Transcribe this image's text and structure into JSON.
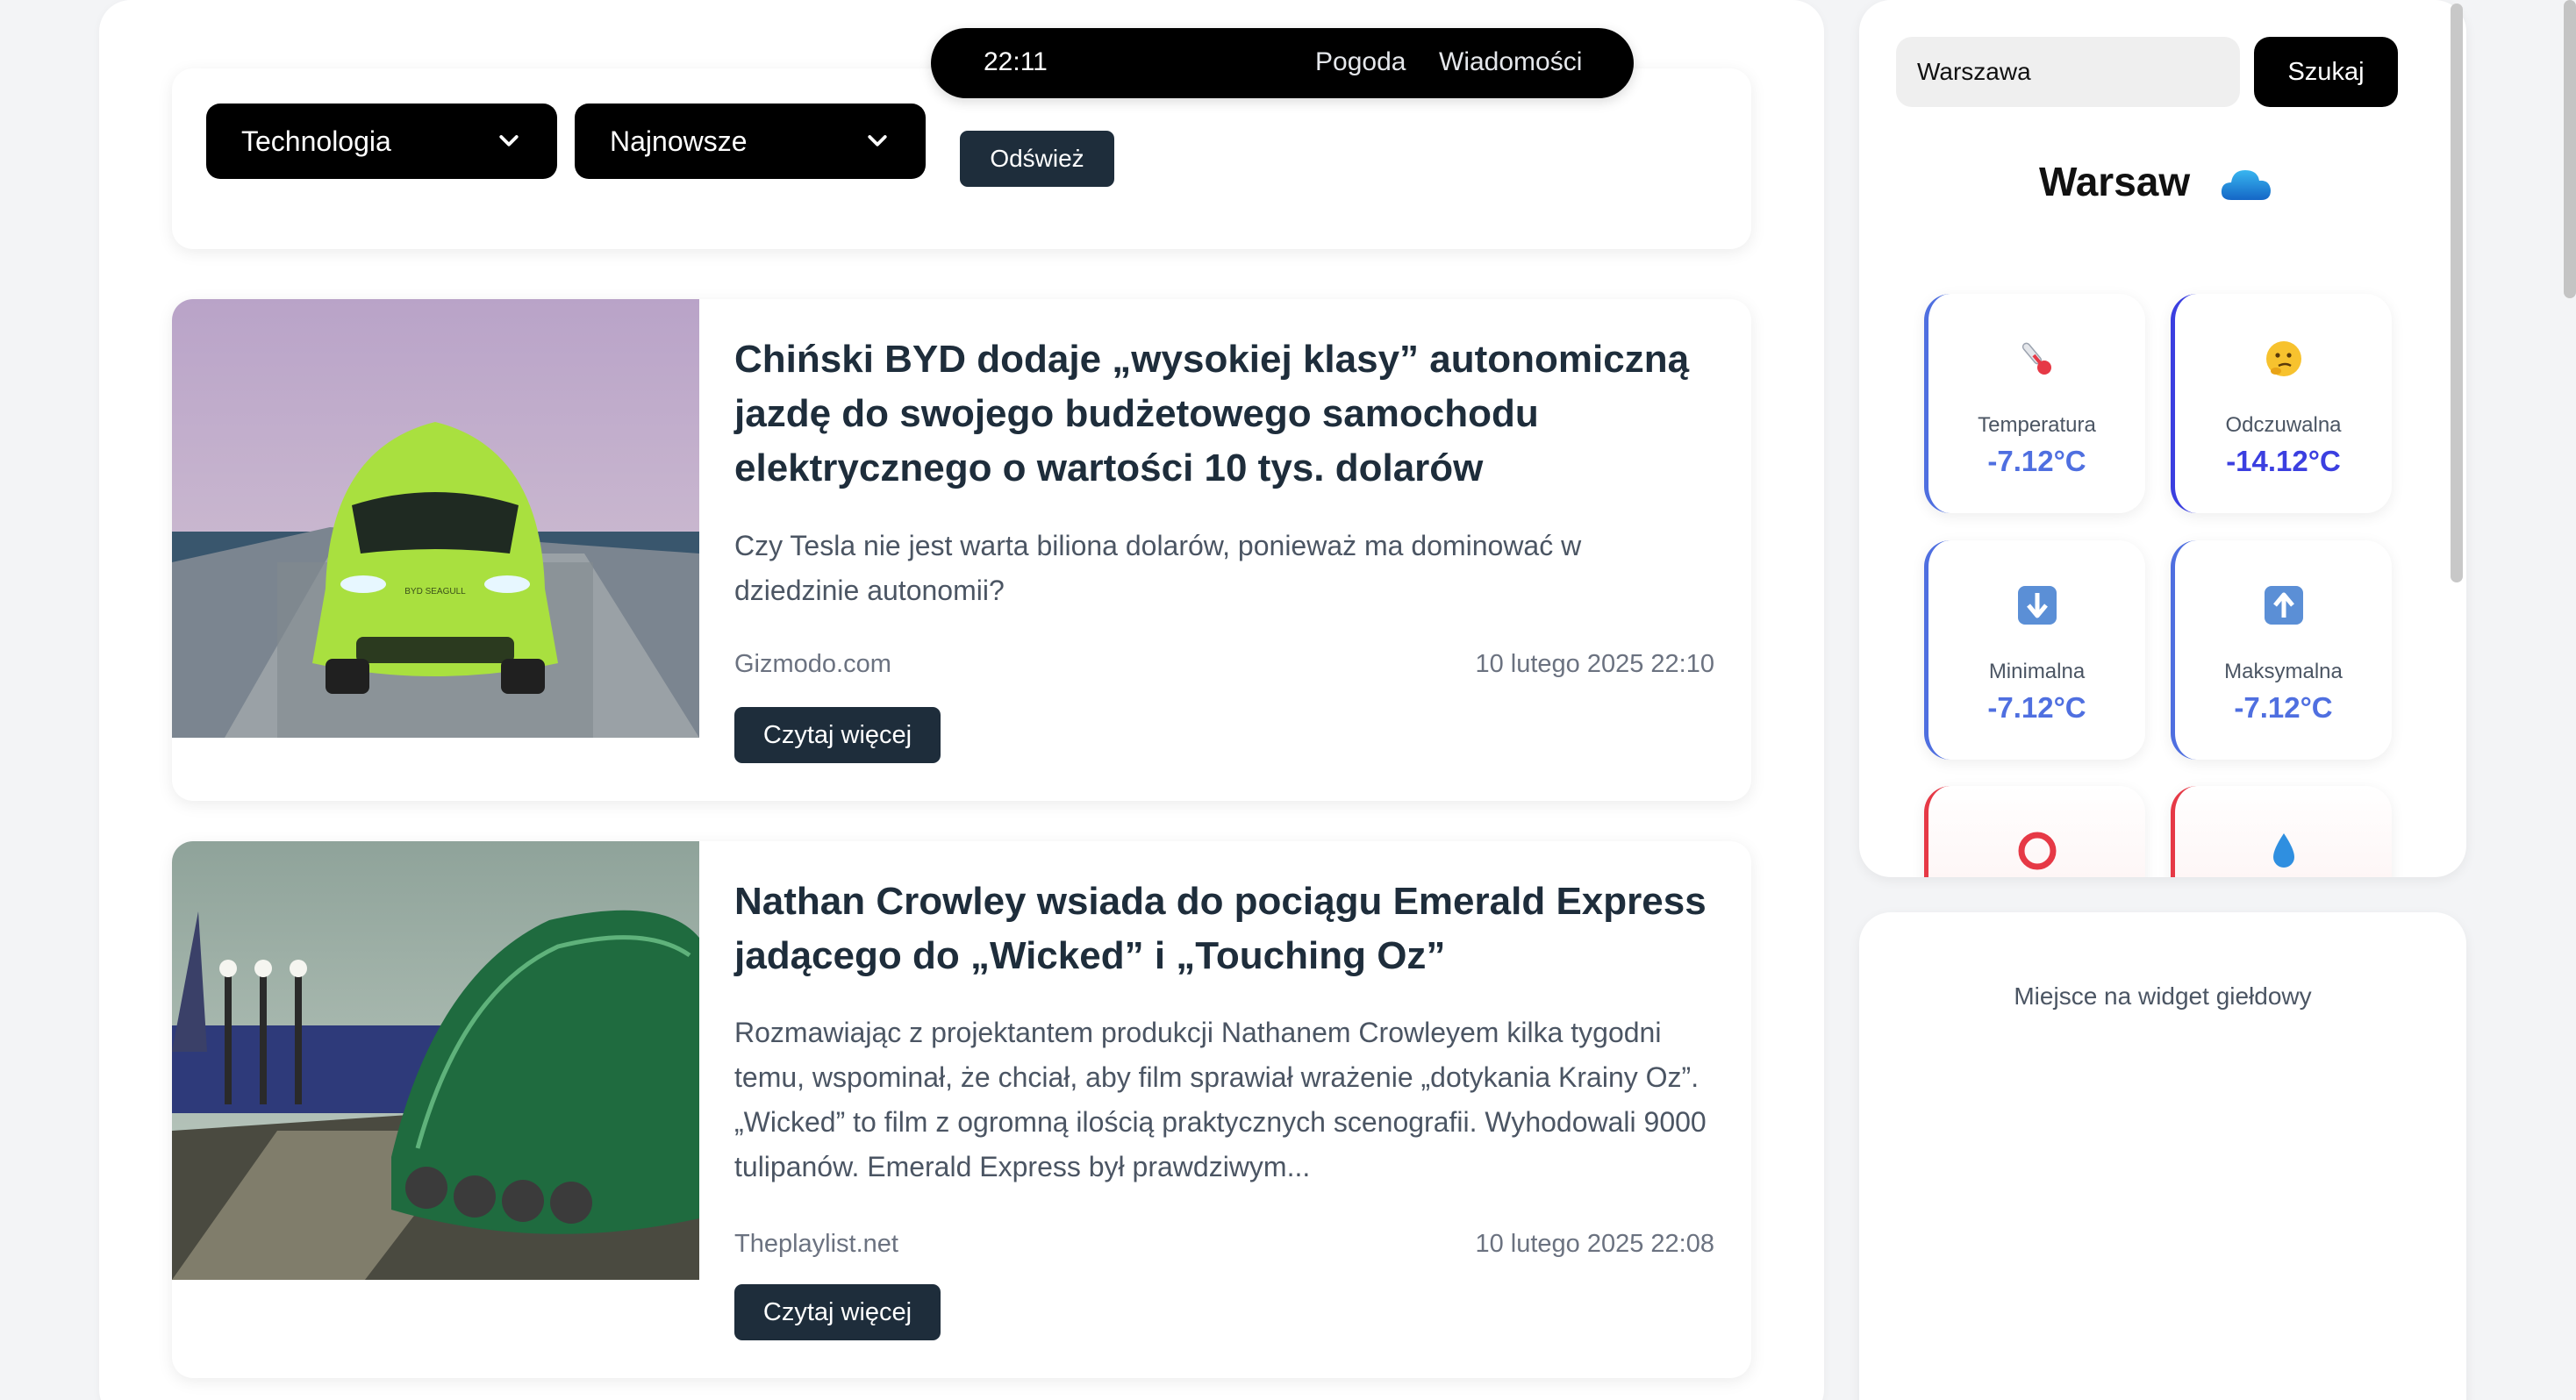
{
  "topnav": {
    "time": "22:11",
    "links": [
      "Pogoda",
      "Wiadomości"
    ]
  },
  "filters": {
    "category": "Technologia",
    "sort": "Najnowsze",
    "refresh_label": "Odśwież"
  },
  "articles": [
    {
      "title": "Chiński BYD dodaje „wysokiej klasy” autonomiczną jazdę do swojego budżetowego samochodu elektrycznego o wartości 10 tys. dolarów",
      "description": "Czy Tesla nie jest warta biliona dolarów, ponieważ ma dominować w dziedzinie autonomii?",
      "source": "Gizmodo.com",
      "date": "10 lutego 2025 22:10",
      "read_more": "Czytaj więcej",
      "image_text": "BYD SEAGULL"
    },
    {
      "title": "Nathan Crowley wsiada do pociągu Emerald Express jadącego do „Wicked” i „Touching Oz”",
      "description": "Rozmawiając z projektantem produkcji Nathanem Crowleyem kilka tygodni temu, wspominał, że chciał, aby film sprawiał wrażenie „dotykania Krainy Oz”. „Wicked” to film z ogromną ilością praktycznych scenografii. Wyhodowali 9000 tulipanów. Emerald Express był prawdziwym...",
      "source": "Theplaylist.net",
      "date": "10 lutego 2025 22:08",
      "read_more": "Czytaj więcej"
    }
  ],
  "weather": {
    "input_value": "Warszawa",
    "search_label": "Szukaj",
    "city": "Warsaw",
    "icon": "cloud-icon",
    "cards": [
      {
        "label": "Temperatura",
        "value": "-7.12°C",
        "icon": "thermometer-icon"
      },
      {
        "label": "Odczuwalna",
        "value": "-14.12°C",
        "icon": "thinking-face-icon"
      },
      {
        "label": "Minimalna",
        "value": "-7.12°C",
        "icon": "arrow-down-icon"
      },
      {
        "label": "Maksymalna",
        "value": "-7.12°C",
        "icon": "arrow-up-icon"
      },
      {
        "label": "",
        "value": "",
        "icon": "ring-icon"
      },
      {
        "label": "",
        "value": "",
        "icon": "droplet-icon"
      }
    ]
  },
  "stock_widget": {
    "placeholder": "Miejsce na widget giełdowy"
  },
  "colors": {
    "dark": "#1e2d3b",
    "accent_blue": "#4f6fe0",
    "accent_red": "#e63946"
  }
}
